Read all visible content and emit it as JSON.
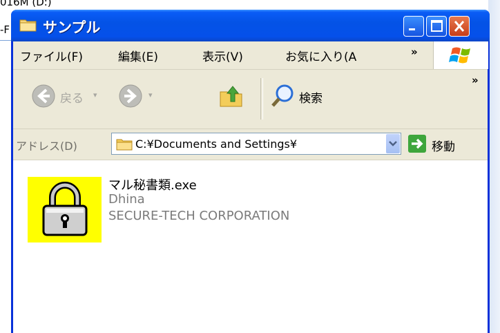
{
  "background": {
    "line1": "016M (D:)",
    "line2": "-F"
  },
  "window": {
    "title": "サンプル",
    "controls": {
      "minimize": "minimize-icon",
      "maximize": "maximize-icon",
      "close": "close-icon"
    }
  },
  "menu": {
    "items": [
      "ファイル(F)",
      "編集(E)",
      "表示(V)",
      "お気に入り(A"
    ],
    "overflow": "»"
  },
  "toolbar": {
    "back": "戻る",
    "search": "検索",
    "overflow": "»",
    "dropdown": "▾"
  },
  "address": {
    "label": "アドレス(D)",
    "value": "C:¥Documents and Settings¥",
    "go": "移動"
  },
  "file": {
    "name": "マル秘書類.exe",
    "author": "Dhina",
    "company": "SECURE-TECH CORPORATION",
    "icon": "padlock-icon"
  },
  "colors": {
    "titlebar": "#0553e6",
    "menubar": "#ece9d8",
    "icon_background": "#ffff00",
    "close_button": "#d8552b"
  }
}
